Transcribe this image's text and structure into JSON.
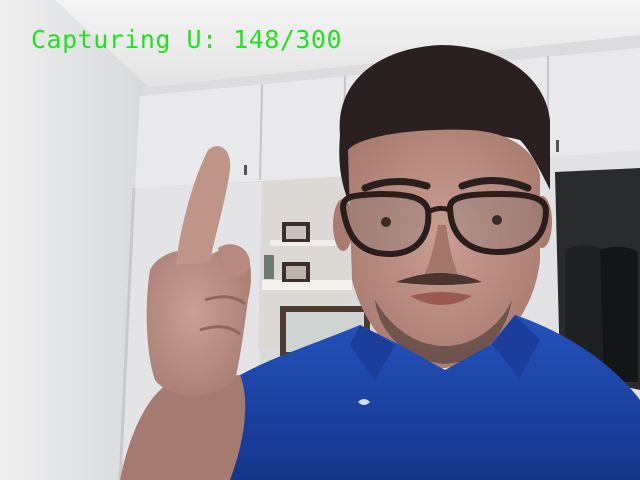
{
  "overlay": {
    "caption": "Capturing U: 148/300",
    "text_color": "#22e022"
  },
  "scene": {
    "description_label": "webcam-frame",
    "colors": {
      "wall": "#e6e6e8",
      "ceiling": "#f2f2f2",
      "cabinet": "#e9eaec",
      "shirt": "#1d44a8",
      "skin": "#b98d83",
      "hair": "#2a2020",
      "dark_door": "#2a2b2d"
    }
  }
}
